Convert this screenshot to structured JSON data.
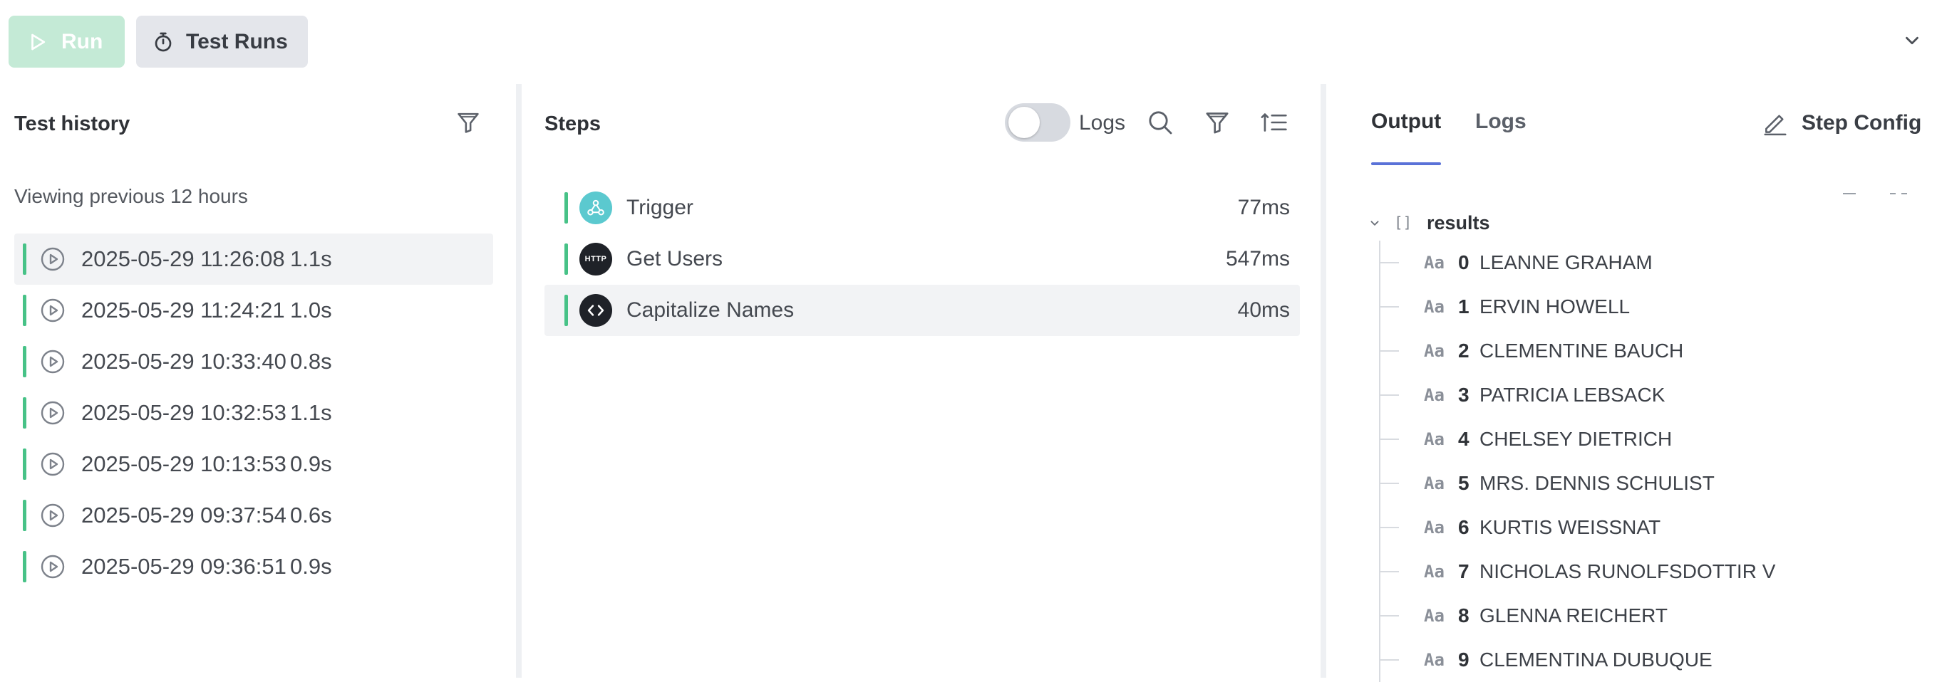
{
  "toolbar": {
    "run_label": "Run",
    "test_runs_label": "Test Runs"
  },
  "history": {
    "title": "Test history",
    "viewing_text": "Viewing previous 12 hours",
    "rows": [
      {
        "date": "2025-05-29 11:26:08",
        "duration": "1.1s"
      },
      {
        "date": "2025-05-29 11:24:21",
        "duration": "1.0s"
      },
      {
        "date": "2025-05-29 10:33:40",
        "duration": "0.8s"
      },
      {
        "date": "2025-05-29 10:32:53",
        "duration": "1.1s"
      },
      {
        "date": "2025-05-29 10:13:53",
        "duration": "0.9s"
      },
      {
        "date": "2025-05-29 09:37:54",
        "duration": "0.6s"
      },
      {
        "date": "2025-05-29 09:36:51",
        "duration": "0.9s"
      }
    ]
  },
  "steps": {
    "title": "Steps",
    "logs_toggle_label": "Logs",
    "items": [
      {
        "name": "Trigger",
        "time": "77ms",
        "icon": "webhook-icon"
      },
      {
        "name": "Get Users",
        "time": "547ms",
        "icon": "http-icon",
        "icon_text": "HTTP"
      },
      {
        "name": "Capitalize Names",
        "time": "40ms",
        "icon": "code-icon"
      }
    ]
  },
  "output": {
    "tabs": [
      "Output",
      "Logs"
    ],
    "step_config_label": "Step Config",
    "root": {
      "bracket": "[]",
      "name": "results"
    },
    "type_glyph": "Aa",
    "items": [
      {
        "index": "0",
        "value": "LEANNE GRAHAM"
      },
      {
        "index": "1",
        "value": "ERVIN HOWELL"
      },
      {
        "index": "2",
        "value": "CLEMENTINE BAUCH"
      },
      {
        "index": "3",
        "value": "PATRICIA LEBSACK"
      },
      {
        "index": "4",
        "value": "CHELSEY DIETRICH"
      },
      {
        "index": "5",
        "value": "MRS. DENNIS SCHULIST"
      },
      {
        "index": "6",
        "value": "KURTIS WEISSNAT"
      },
      {
        "index": "7",
        "value": "NICHOLAS RUNOLFSDOTTIR V"
      },
      {
        "index": "8",
        "value": "GLENNA REICHERT"
      },
      {
        "index": "9",
        "value": "CLEMENTINA DUBUQUE"
      }
    ]
  },
  "colors": {
    "accent_green": "#47c287",
    "run_button_disabled": "#c4ead6",
    "tab_underline": "#5a72d8"
  }
}
